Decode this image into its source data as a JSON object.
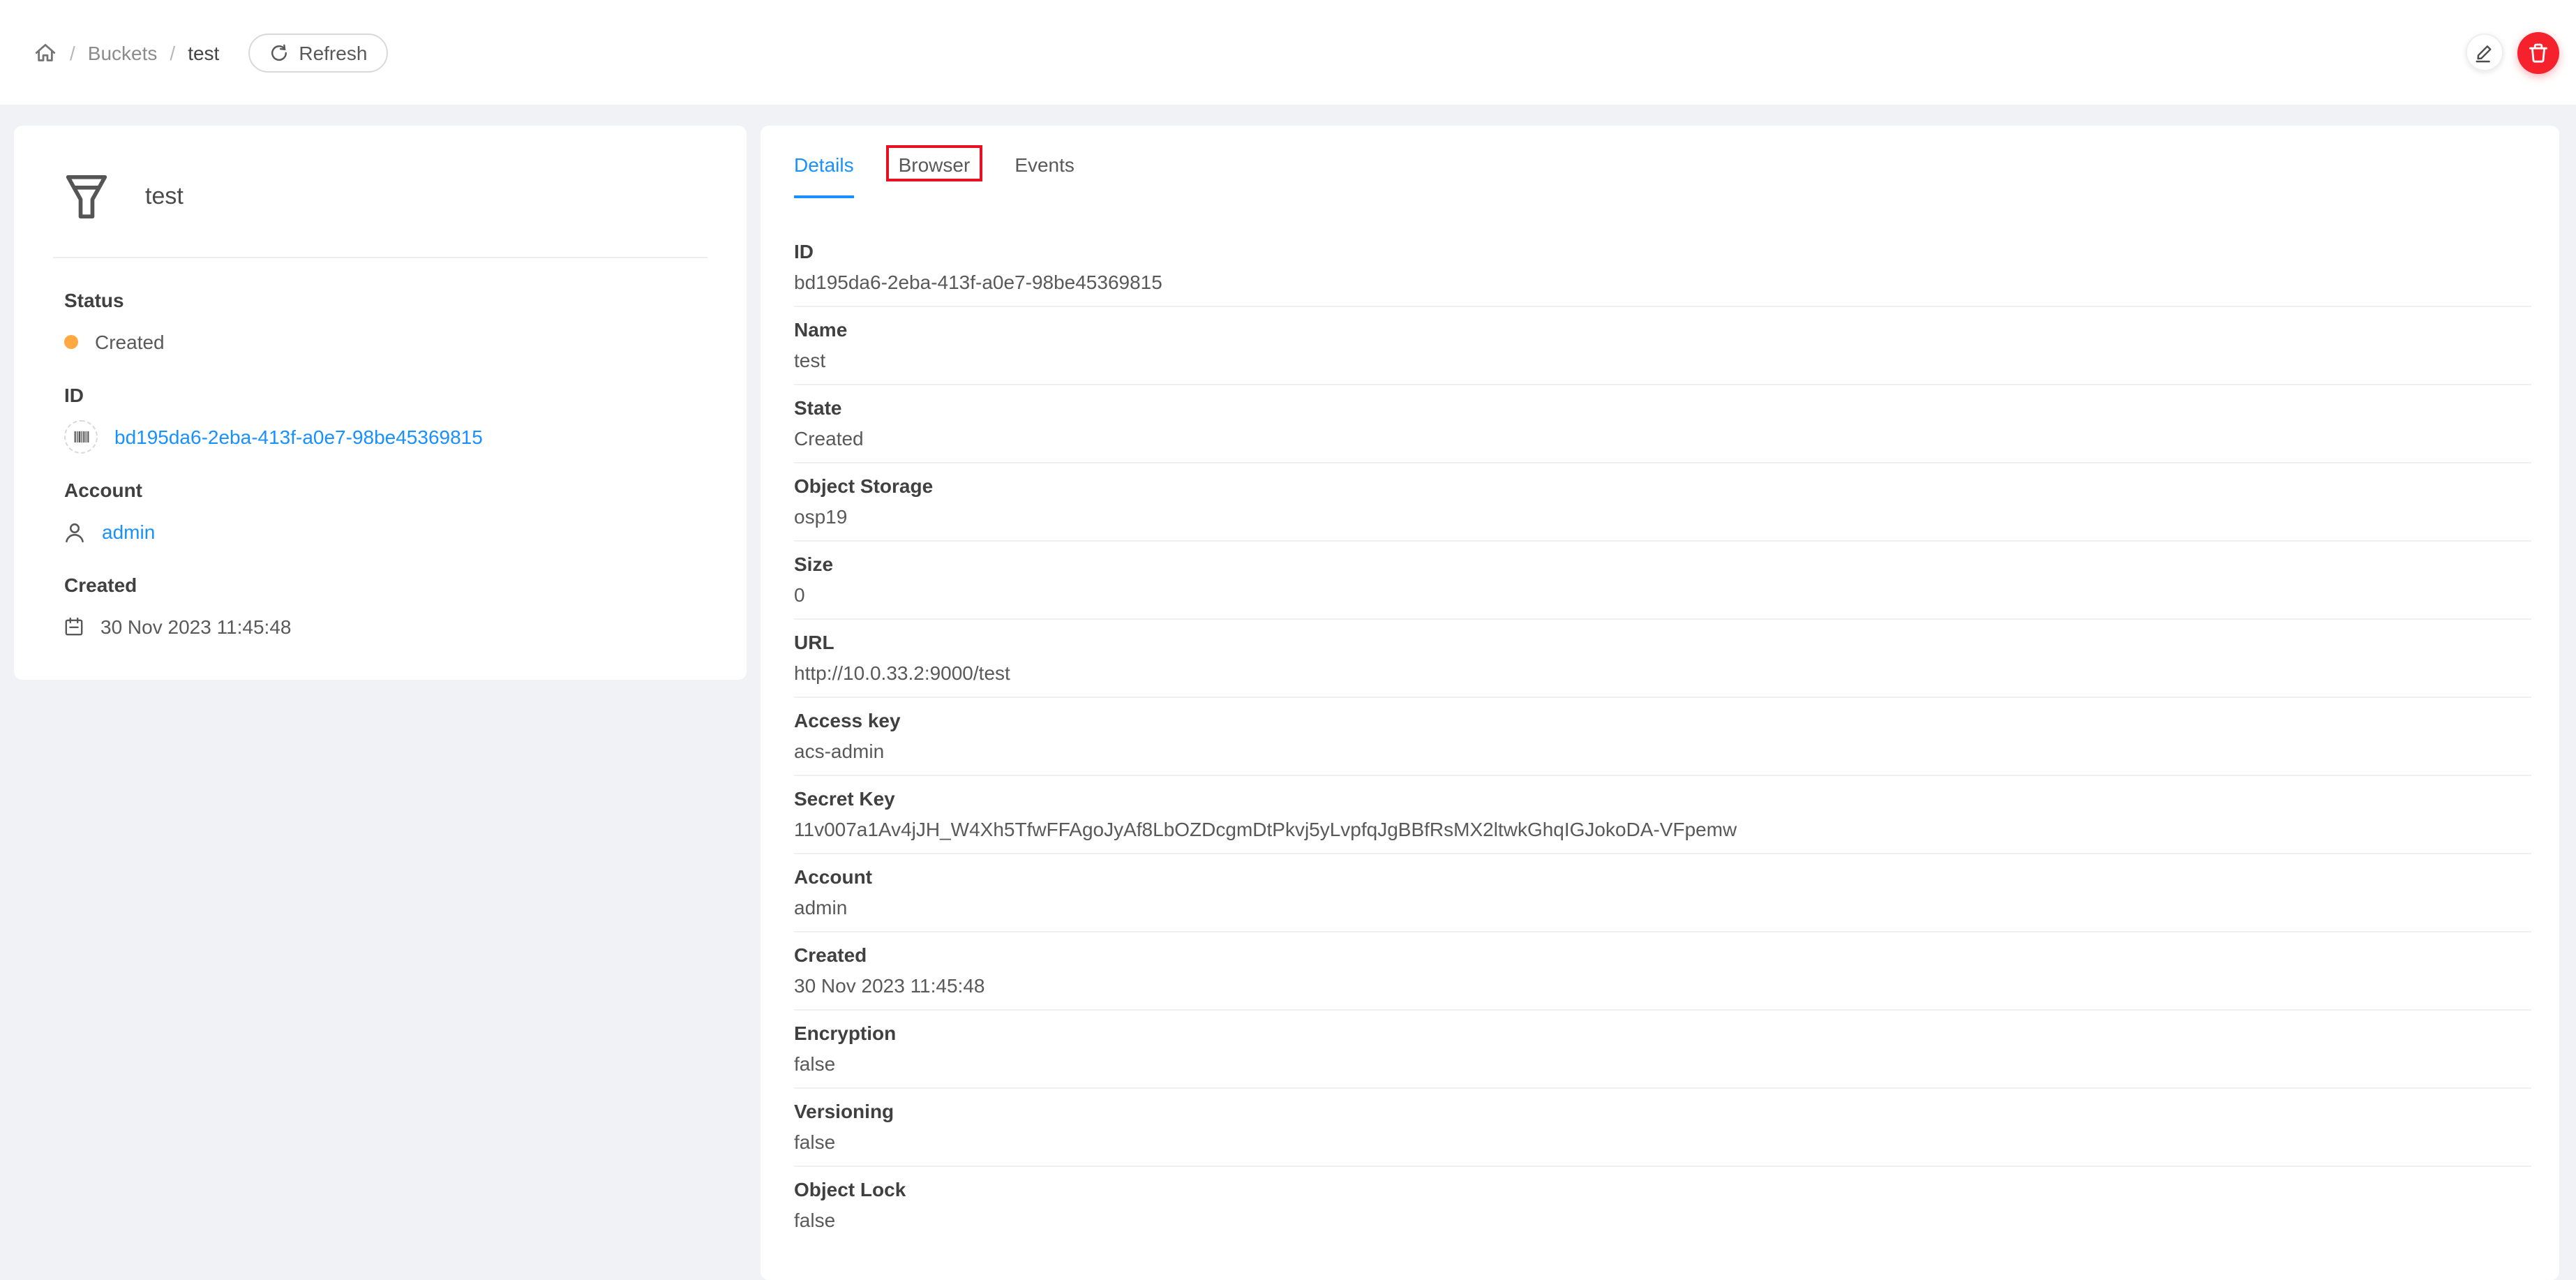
{
  "theme": {
    "accent": "#1890ff",
    "danger": "#f5222d",
    "warning": "#ffa940",
    "annotation": "#e81123",
    "page_bg": "#f0f2f5",
    "card_bg": "#ffffff"
  },
  "breadcrumb": {
    "separator": "/",
    "items": [
      {
        "label": "Buckets"
      },
      {
        "label": "test"
      }
    ]
  },
  "toolbar": {
    "refresh_label": "Refresh"
  },
  "icons": {
    "home": "home-icon",
    "refresh": "reload-icon",
    "edit": "edit-icon",
    "delete": "trash-icon",
    "resource": "bucket-icon",
    "id_badge": "barcode-icon",
    "account": "user-icon",
    "created": "calendar-icon"
  },
  "info_card": {
    "title": "test",
    "sections": [
      {
        "label": "Status",
        "value": "Created"
      },
      {
        "label": "ID",
        "value": "bd195da6-2eba-413f-a0e7-98be45369815"
      },
      {
        "label": "Account",
        "value": "admin"
      },
      {
        "label": "Created",
        "value": "30 Nov 2023 11:45:48"
      }
    ]
  },
  "tabs": [
    {
      "label": "Details",
      "active": true,
      "annotated": false
    },
    {
      "label": "Browser",
      "active": false,
      "annotated": true
    },
    {
      "label": "Events",
      "active": false,
      "annotated": false
    }
  ],
  "details": {
    "fields": [
      {
        "label": "ID",
        "value": "bd195da6-2eba-413f-a0e7-98be45369815"
      },
      {
        "label": "Name",
        "value": "test"
      },
      {
        "label": "State",
        "value": "Created"
      },
      {
        "label": "Object Storage",
        "value": "osp19"
      },
      {
        "label": "Size",
        "value": "0"
      },
      {
        "label": "URL",
        "value": "http://10.0.33.2:9000/test"
      },
      {
        "label": "Access key",
        "value": "acs-admin"
      },
      {
        "label": "Secret Key",
        "value": "11v007a1Av4jJH_W4Xh5TfwFFAgoJyAf8LbOZDcgmDtPkvj5yLvpfqJgBBfRsMX2ltwkGhqIGJokoDA-VFpemw"
      },
      {
        "label": "Account",
        "value": "admin"
      },
      {
        "label": "Created",
        "value": "30 Nov 2023 11:45:48"
      },
      {
        "label": "Encryption",
        "value": "false"
      },
      {
        "label": "Versioning",
        "value": "false"
      },
      {
        "label": "Object Lock",
        "value": "false"
      }
    ]
  }
}
